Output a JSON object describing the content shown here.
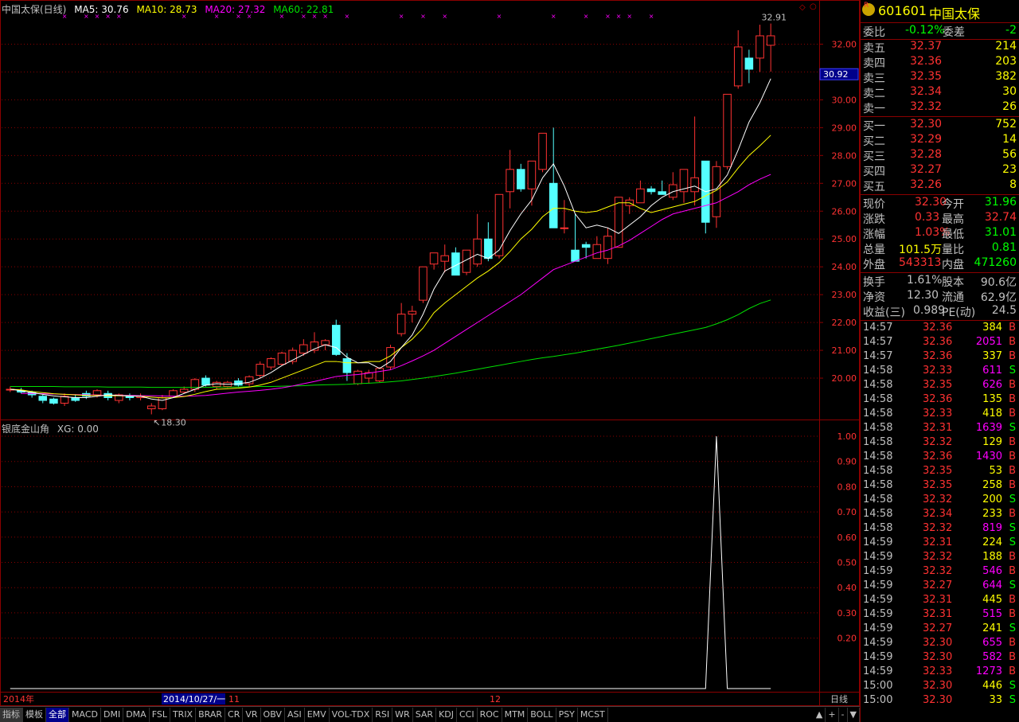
{
  "header": {
    "title": "中国太保(日线)",
    "ma5": "MA5: 30.76",
    "ma10": "MA10: 28.73",
    "ma20": "MA20: 27.32",
    "ma60": "MA60: 22.81"
  },
  "sub_header": {
    "title": "银底金山角",
    "xg": "XG: 0.00"
  },
  "price_axis": [
    "32.00",
    "31.00",
    "30.00",
    "29.00",
    "28.00",
    "27.00",
    "26.00",
    "25.00",
    "24.00",
    "23.00",
    "22.00",
    "21.00",
    "20.00"
  ],
  "price_marker": "30.92",
  "sub_axis": [
    "1.00",
    "0.90",
    "0.80",
    "0.70",
    "0.60",
    "0.50",
    "0.40",
    "0.30",
    "0.20"
  ],
  "annotations": {
    "high": "32.91",
    "low": "18.30"
  },
  "date_axis": {
    "year": "2014年",
    "cursor": "2014/10/27/一",
    "m11": "11",
    "m12": "12",
    "period": "日线"
  },
  "colors": {
    "up": "#ff3232",
    "down": "#54ffff",
    "ma5": "#ffffff",
    "ma10": "#ffff00",
    "ma20": "#ff00ff",
    "ma60": "#00e000",
    "grid": "#8b0000"
  },
  "bottom_bar": {
    "tabs": [
      "指标",
      "模板",
      "全部",
      "MACD",
      "DMI",
      "DMA",
      "FSL",
      "TRIX",
      "BRAR",
      "CR",
      "VR",
      "OBV",
      "ASI",
      "EMV",
      "VOL-TDX",
      "RSI",
      "WR",
      "SAR",
      "KDJ",
      "CCI",
      "ROC",
      "MTM",
      "BOLL",
      "PSY",
      "MCST"
    ],
    "controls": [
      "▲",
      "+",
      "-",
      "▼"
    ]
  },
  "quote": {
    "code": "601601",
    "name": "中国太保",
    "badge": "R",
    "webi": {
      "label": "委比",
      "value": "-0.12%",
      "label2": "委差",
      "value2": "-2"
    },
    "sell": [
      {
        "label": "卖五",
        "price": "32.37",
        "vol": "214"
      },
      {
        "label": "卖四",
        "price": "32.36",
        "vol": "203"
      },
      {
        "label": "卖三",
        "price": "32.35",
        "vol": "382"
      },
      {
        "label": "卖二",
        "price": "32.34",
        "vol": "30"
      },
      {
        "label": "卖一",
        "price": "32.32",
        "vol": "26"
      }
    ],
    "buy": [
      {
        "label": "买一",
        "price": "32.30",
        "vol": "752"
      },
      {
        "label": "买二",
        "price": "32.29",
        "vol": "14"
      },
      {
        "label": "买三",
        "price": "32.28",
        "vol": "56"
      },
      {
        "label": "买四",
        "price": "32.27",
        "vol": "23"
      },
      {
        "label": "买五",
        "price": "32.26",
        "vol": "8"
      }
    ],
    "stats": [
      {
        "l1": "现价",
        "v1": "32.30",
        "l2": "今开",
        "v2": "31.96",
        "c1": "#ff3232",
        "c2": "#00ff00"
      },
      {
        "l1": "涨跌",
        "v1": "0.33",
        "l2": "最高",
        "v2": "32.74",
        "c1": "#ff3232",
        "c2": "#ff3232"
      },
      {
        "l1": "涨幅",
        "v1": "1.03%",
        "l2": "最低",
        "v2": "31.01",
        "c1": "#ff3232",
        "c2": "#00ff00"
      },
      {
        "l1": "总量",
        "v1": "101.5万",
        "l2": "量比",
        "v2": "0.81",
        "c1": "#ffff00",
        "c2": "#00ff00"
      },
      {
        "l1": "外盘",
        "v1": "543313",
        "l2": "内盘",
        "v2": "471260",
        "c1": "#ff3232",
        "c2": "#00ff00"
      }
    ],
    "stats2": [
      {
        "l1": "换手",
        "v1": "1.61%",
        "l2": "股本",
        "v2": "90.6亿"
      },
      {
        "l1": "净资",
        "v1": "12.30",
        "l2": "流通",
        "v2": "62.9亿"
      },
      {
        "l1": "收益(三)",
        "v1": "0.989",
        "l2": "PE(动)",
        "v2": "24.5"
      }
    ],
    "ticks": [
      {
        "t": "14:57",
        "p": "32.36",
        "v": "384",
        "s": "B"
      },
      {
        "t": "14:57",
        "p": "32.36",
        "v": "2051",
        "s": "B"
      },
      {
        "t": "14:57",
        "p": "32.36",
        "v": "337",
        "s": "B"
      },
      {
        "t": "14:58",
        "p": "32.33",
        "v": "611",
        "s": "S"
      },
      {
        "t": "14:58",
        "p": "32.35",
        "v": "626",
        "s": "B"
      },
      {
        "t": "14:58",
        "p": "32.36",
        "v": "135",
        "s": "B"
      },
      {
        "t": "14:58",
        "p": "32.33",
        "v": "418",
        "s": "B"
      },
      {
        "t": "14:58",
        "p": "32.31",
        "v": "1639",
        "s": "S"
      },
      {
        "t": "14:58",
        "p": "32.32",
        "v": "129",
        "s": "B"
      },
      {
        "t": "14:58",
        "p": "32.36",
        "v": "1430",
        "s": "B"
      },
      {
        "t": "14:58",
        "p": "32.35",
        "v": "53",
        "s": "B"
      },
      {
        "t": "14:58",
        "p": "32.35",
        "v": "258",
        "s": "B"
      },
      {
        "t": "14:58",
        "p": "32.32",
        "v": "200",
        "s": "S"
      },
      {
        "t": "14:58",
        "p": "32.34",
        "v": "233",
        "s": "B"
      },
      {
        "t": "14:58",
        "p": "32.32",
        "v": "819",
        "s": "S"
      },
      {
        "t": "14:59",
        "p": "32.31",
        "v": "224",
        "s": "S"
      },
      {
        "t": "14:59",
        "p": "32.32",
        "v": "188",
        "s": "B"
      },
      {
        "t": "14:59",
        "p": "32.32",
        "v": "546",
        "s": "B"
      },
      {
        "t": "14:59",
        "p": "32.27",
        "v": "644",
        "s": "S"
      },
      {
        "t": "14:59",
        "p": "32.31",
        "v": "445",
        "s": "B"
      },
      {
        "t": "14:59",
        "p": "32.31",
        "v": "515",
        "s": "B"
      },
      {
        "t": "14:59",
        "p": "32.27",
        "v": "241",
        "s": "S"
      },
      {
        "t": "14:59",
        "p": "32.30",
        "v": "655",
        "s": "B"
      },
      {
        "t": "14:59",
        "p": "32.30",
        "v": "582",
        "s": "B"
      },
      {
        "t": "14:59",
        "p": "32.33",
        "v": "1273",
        "s": "B"
      },
      {
        "t": "15:00",
        "p": "32.30",
        "v": "446",
        "s": "S"
      },
      {
        "t": "15:00",
        "p": "32.30",
        "v": "33",
        "s": "S"
      }
    ]
  },
  "chart_data": [
    {
      "type": "candlestick",
      "ylim": [
        18.8,
        32.9
      ],
      "ohlc": [
        [
          19.6,
          19.7,
          19.5,
          19.6
        ],
        [
          19.55,
          19.65,
          19.45,
          19.5
        ],
        [
          19.5,
          19.55,
          19.3,
          19.4
        ],
        [
          19.35,
          19.4,
          19.1,
          19.2
        ],
        [
          19.25,
          19.3,
          19.05,
          19.1
        ],
        [
          19.1,
          19.45,
          19.0,
          19.35
        ],
        [
          19.3,
          19.4,
          19.15,
          19.2
        ],
        [
          19.45,
          19.55,
          19.25,
          19.35
        ],
        [
          19.4,
          19.6,
          19.3,
          19.55
        ],
        [
          19.45,
          19.55,
          19.2,
          19.3
        ],
        [
          19.2,
          19.45,
          19.1,
          19.4
        ],
        [
          19.35,
          19.45,
          19.2,
          19.3
        ],
        [
          19.3,
          19.45,
          19.2,
          19.35
        ],
        [
          18.9,
          19.1,
          18.7,
          19.0
        ],
        [
          18.9,
          19.4,
          18.85,
          19.3
        ],
        [
          19.35,
          19.6,
          19.3,
          19.55
        ],
        [
          19.5,
          19.7,
          19.45,
          19.6
        ],
        [
          19.6,
          20.0,
          19.5,
          19.95
        ],
        [
          20.0,
          20.1,
          19.7,
          19.75
        ],
        [
          19.7,
          19.9,
          19.6,
          19.85
        ],
        [
          19.7,
          19.9,
          19.65,
          19.85
        ],
        [
          19.9,
          20.0,
          19.7,
          19.75
        ],
        [
          19.8,
          20.1,
          19.7,
          20.05
        ],
        [
          20.1,
          20.6,
          20.0,
          20.5
        ],
        [
          20.4,
          20.75,
          20.3,
          20.7
        ],
        [
          20.5,
          20.95,
          20.45,
          20.9
        ],
        [
          20.6,
          21.1,
          20.5,
          21.0
        ],
        [
          20.9,
          21.4,
          20.8,
          21.2
        ],
        [
          21.0,
          21.65,
          20.9,
          21.3
        ],
        [
          21.2,
          21.4,
          21.0,
          21.35
        ],
        [
          21.9,
          22.1,
          20.8,
          20.85
        ],
        [
          20.7,
          20.9,
          19.9,
          20.2
        ],
        [
          19.8,
          20.3,
          19.75,
          20.25
        ],
        [
          20.0,
          20.3,
          19.8,
          20.2
        ],
        [
          19.9,
          20.4,
          19.85,
          20.35
        ],
        [
          20.4,
          21.2,
          20.3,
          21.1
        ],
        [
          21.6,
          22.7,
          21.5,
          22.3
        ],
        [
          22.3,
          22.6,
          22.0,
          22.4
        ],
        [
          22.8,
          24.0,
          22.7,
          24.0
        ],
        [
          24.1,
          24.5,
          23.9,
          24.5
        ],
        [
          24.2,
          24.8,
          23.8,
          24.4
        ],
        [
          24.5,
          24.7,
          23.9,
          23.7
        ],
        [
          23.8,
          24.6,
          23.7,
          24.6
        ],
        [
          24.1,
          25.9,
          24.0,
          25.0
        ],
        [
          25.0,
          25.6,
          24.2,
          24.3
        ],
        [
          24.4,
          26.6,
          24.3,
          26.6
        ],
        [
          26.7,
          28.2,
          26.1,
          27.5
        ],
        [
          27.5,
          27.7,
          26.7,
          26.8
        ],
        [
          26.8,
          27.8,
          26.2,
          27.8
        ],
        [
          27.5,
          28.8,
          27.4,
          28.8
        ],
        [
          27.0,
          29.0,
          25.8,
          25.4
        ],
        [
          25.4,
          26.4,
          25.2,
          25.4
        ],
        [
          24.6,
          25.9,
          24.2,
          24.2
        ],
        [
          24.8,
          24.9,
          24.3,
          24.7
        ],
        [
          24.3,
          25.1,
          24.4,
          24.8
        ],
        [
          24.3,
          25.4,
          24.1,
          25.1
        ],
        [
          24.7,
          26.5,
          24.8,
          26.5
        ],
        [
          26.2,
          26.5,
          25.9,
          26.4
        ],
        [
          26.3,
          27.1,
          26.3,
          26.8
        ],
        [
          26.8,
          26.9,
          26.6,
          26.7
        ],
        [
          26.7,
          27.1,
          26.6,
          26.6
        ],
        [
          26.5,
          27.4,
          26.4,
          26.95
        ],
        [
          26.7,
          27.5,
          26.3,
          27.5
        ],
        [
          26.7,
          29.4,
          26.2,
          27.2
        ],
        [
          27.8,
          27.8,
          25.2,
          25.6
        ],
        [
          25.8,
          27.8,
          25.4,
          27.6
        ],
        [
          27.6,
          30.2,
          27.5,
          30.2
        ],
        [
          30.5,
          32.5,
          30.4,
          31.9
        ],
        [
          31.5,
          31.8,
          30.6,
          31.1
        ],
        [
          31.5,
          32.7,
          31.0,
          32.3
        ],
        [
          31.96,
          32.74,
          31.01,
          32.3
        ]
      ],
      "ma5": [
        19.6,
        19.55,
        19.48,
        19.42,
        19.36,
        19.33,
        19.3,
        19.3,
        19.35,
        19.4,
        19.38,
        19.36,
        19.35,
        19.25,
        19.2,
        19.3,
        19.45,
        19.6,
        19.75,
        19.8,
        19.78,
        19.8,
        19.85,
        20,
        20.2,
        20.45,
        20.65,
        20.85,
        21.05,
        21.2,
        21.1,
        20.75,
        20.55,
        20.55,
        20.35,
        20.6,
        21.1,
        21.55,
        22.3,
        23.2,
        23.85,
        24.05,
        24.25,
        24.45,
        24.3,
        24.6,
        25.3,
        25.9,
        26.4,
        27.2,
        27.7,
        26.9,
        25.9,
        25.4,
        25.5,
        25.4,
        25.2,
        25.5,
        25.8,
        26.2,
        26.5,
        26.7,
        26.8,
        26.9,
        26.7,
        26.8,
        27.3,
        28.2,
        29.2,
        29.9,
        30.76
      ],
      "ma10": [
        19.6,
        19.58,
        19.52,
        19.48,
        19.44,
        19.42,
        19.4,
        19.38,
        19.38,
        19.37,
        19.37,
        19.36,
        19.35,
        19.32,
        19.29,
        19.3,
        19.34,
        19.42,
        19.52,
        19.6,
        19.62,
        19.64,
        19.68,
        19.75,
        19.85,
        20,
        20.15,
        20.3,
        20.45,
        20.6,
        20.6,
        20.55,
        20.55,
        20.6,
        20.6,
        20.8,
        21.1,
        21.4,
        21.8,
        22.35,
        22.7,
        23,
        23.3,
        23.6,
        23.85,
        24.15,
        24.55,
        25,
        25.35,
        25.8,
        26.1,
        26.1,
        26,
        25.95,
        26,
        26.15,
        26.3,
        26.3,
        26.1,
        25.95,
        26.05,
        26.15,
        26.25,
        26.35,
        26.55,
        26.75,
        27.05,
        27.55,
        28,
        28.35,
        28.73
      ],
      "ma20": [
        19.45,
        19.45,
        19.44,
        19.43,
        19.42,
        19.41,
        19.4,
        19.39,
        19.38,
        19.38,
        19.38,
        19.37,
        19.37,
        19.36,
        19.35,
        19.35,
        19.36,
        19.38,
        19.42,
        19.46,
        19.5,
        19.53,
        19.56,
        19.6,
        19.65,
        19.72,
        19.8,
        19.88,
        19.97,
        20.06,
        20.1,
        20.13,
        20.18,
        20.24,
        20.3,
        20.45,
        20.62,
        20.8,
        21,
        21.25,
        21.5,
        21.75,
        22,
        22.25,
        22.5,
        22.75,
        23,
        23.3,
        23.6,
        23.9,
        24.05,
        24.2,
        24.35,
        24.5,
        24.6,
        24.75,
        24.95,
        25.2,
        25.45,
        25.7,
        25.9,
        26,
        26.1,
        26.2,
        26.3,
        26.5,
        26.7,
        26.95,
        27.15,
        27.32
      ],
      "ma60": [
        19.7,
        19.7,
        19.7,
        19.7,
        19.7,
        19.69,
        19.69,
        19.69,
        19.69,
        19.68,
        19.68,
        19.68,
        19.68,
        19.67,
        19.67,
        19.67,
        19.67,
        19.67,
        19.67,
        19.68,
        19.68,
        19.68,
        19.69,
        19.7,
        19.7,
        19.71,
        19.72,
        19.73,
        19.75,
        19.76,
        19.77,
        19.78,
        19.8,
        19.82,
        19.84,
        19.87,
        19.9,
        19.95,
        20,
        20.06,
        20.12,
        20.18,
        20.25,
        20.32,
        20.39,
        20.46,
        20.53,
        20.6,
        20.67,
        20.73,
        20.78,
        20.84,
        20.9,
        20.97,
        21.04,
        21.11,
        21.18,
        21.26,
        21.34,
        21.42,
        21.5,
        21.58,
        21.66,
        21.74,
        21.82,
        21.95,
        22.1,
        22.28,
        22.5,
        22.68,
        22.81
      ]
    },
    {
      "type": "line",
      "name": "XG",
      "ylim": [
        0,
        1
      ],
      "values": [
        0,
        0,
        0,
        0,
        0,
        0,
        0,
        0,
        0,
        0,
        0,
        0,
        0,
        0,
        0,
        0,
        0,
        0,
        0,
        0,
        0,
        0,
        0,
        0,
        0,
        0,
        0,
        0,
        0,
        0,
        0,
        0,
        0,
        0,
        0,
        0,
        0,
        0,
        0,
        0,
        0,
        0,
        0,
        0,
        0,
        0,
        0,
        0,
        0,
        0,
        0,
        0,
        0,
        0,
        0,
        0,
        0,
        0,
        0,
        0,
        0,
        0,
        0,
        0,
        0,
        1,
        0,
        0,
        0,
        0,
        0
      ]
    }
  ]
}
